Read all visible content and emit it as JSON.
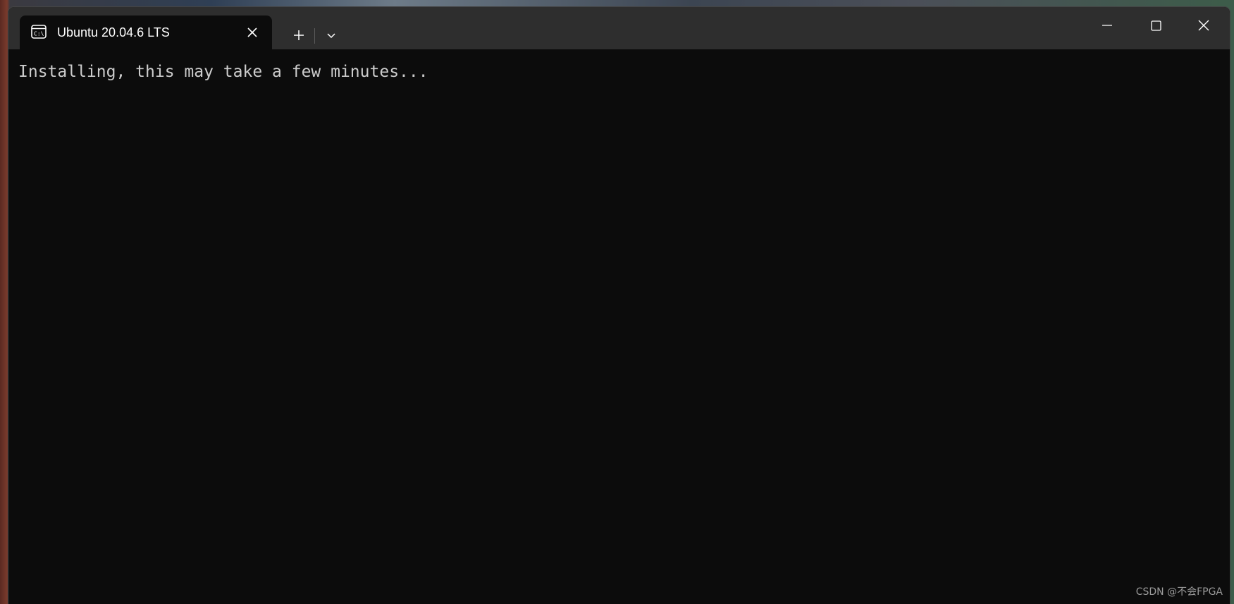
{
  "window": {
    "tab_title": "Ubuntu 20.04.6 LTS",
    "icons": {
      "tab": "terminal-icon",
      "tab_close": "close-icon",
      "new_tab": "plus-icon",
      "dropdown": "chevron-down-icon",
      "minimize": "minimize-icon",
      "maximize": "maximize-icon",
      "close": "close-icon"
    }
  },
  "terminal": {
    "lines": [
      "Installing, this may take a few minutes..."
    ]
  },
  "watermark": "CSDN @不会FPGA",
  "colors": {
    "titlebar": "#2e2e2e",
    "terminal_bg": "#0c0c0c",
    "terminal_text": "#cccccc"
  }
}
